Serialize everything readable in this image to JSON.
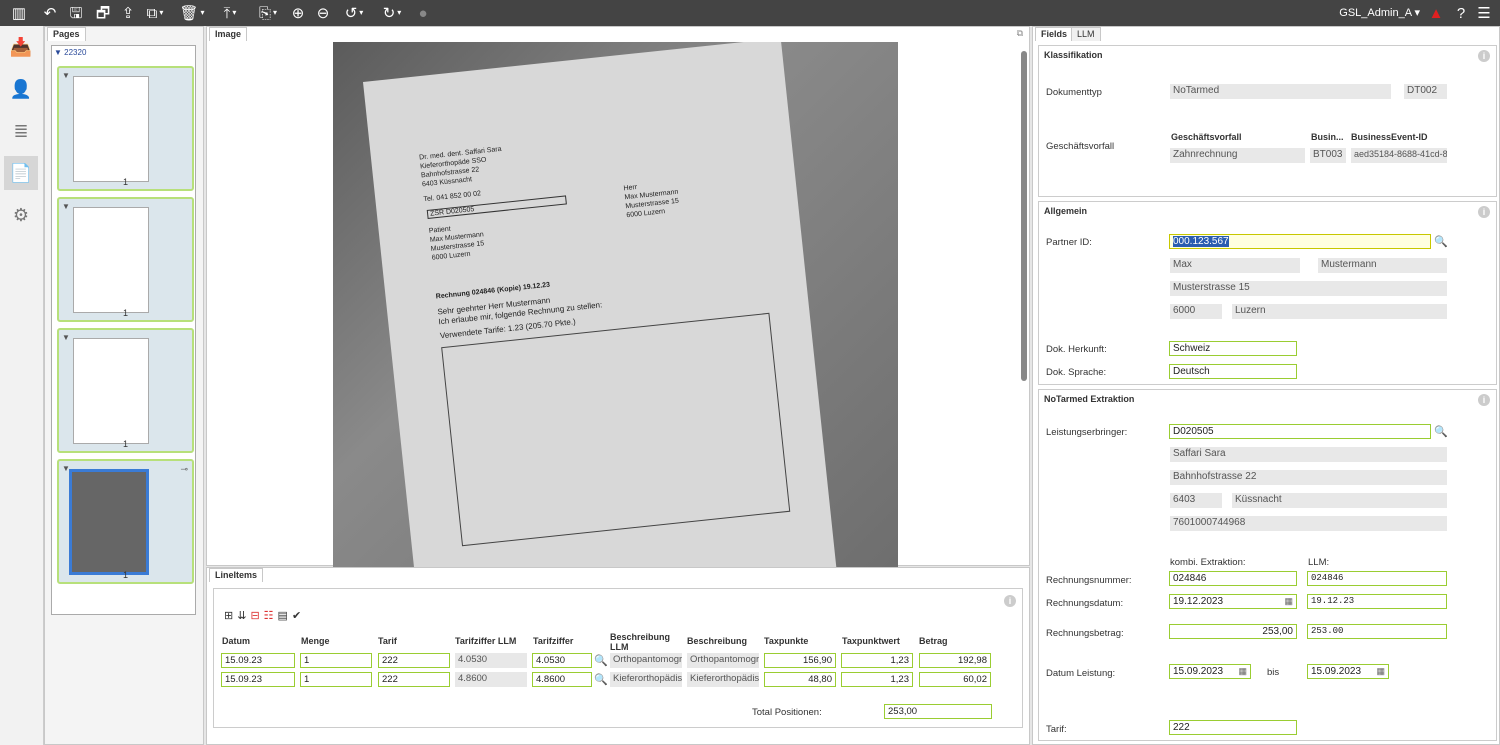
{
  "topbar": {
    "user": "GSL_Admin_A"
  },
  "pages": {
    "tab": "Pages",
    "group": "22320",
    "thumbs": [
      "1",
      "1",
      "1",
      "1"
    ]
  },
  "image": {
    "tab": "Image",
    "doc_lines": [
      "Dr. med. dent. Saffari Sara",
      "Kieferorthopäde SSO",
      "Bahnhofstrasse 22",
      "6403 Küssnacht",
      "Tel. 041 852 00 02",
      "ZSR D020505",
      "Patient",
      "Max Mustermann",
      "Musterstrasse 15",
      "6000 Luzern",
      "Herr",
      "Max Mustermann",
      "Musterstrasse 15",
      "6000 Luzern",
      "Rechnung 024846 (Kopie)    19.12.23",
      "Sehr geehrter Herr Mustermann",
      "Ich erlaube mir, folgende Rechnung zu stellen:",
      "Verwendete Tarife: 1.23 (205.70 Pkte.)"
    ]
  },
  "lineitems": {
    "tab": "LineItems",
    "headers": [
      "Datum",
      "Menge",
      "Tarif",
      "Tarifziffer LLM",
      "Tarifziffer",
      "Beschreibung LLM",
      "Beschreibung",
      "Taxpunkte",
      "Taxpunktwert",
      "Betrag"
    ],
    "rows": [
      [
        "15.09.23",
        "1",
        "222",
        "4.0530",
        "4.0530",
        "Orthopantomogra",
        "Orthopantomogra",
        "156,90",
        "1,23",
        "192,98"
      ],
      [
        "15.09.23",
        "1",
        "222",
        "4.8600",
        "4.8600",
        "Kieferorthopädisc",
        "Kieferorthopädisc",
        "48,80",
        "1,23",
        "60,02"
      ]
    ],
    "total_label": "Total Positionen:",
    "total_value": "253,00"
  },
  "fields": {
    "tabs": [
      "Fields",
      "LLM"
    ],
    "klass": {
      "title": "Klassifikation",
      "doctype_label": "Dokumenttyp",
      "doctype": "NoTarmed",
      "doctype_code": "DT002",
      "gv_label": "Geschäftsvorfall",
      "col1": "Geschäftsvorfall",
      "col2": "Busin...",
      "col3": "BusinessEvent-ID",
      "gv": "Zahnrechnung",
      "bt": "BT003",
      "beid": "aed35184-8688-41cd-8"
    },
    "allg": {
      "title": "Allgemein",
      "partner_label": "Partner ID:",
      "partner": "000.123.567",
      "first": "Max",
      "last": "Mustermann",
      "street": "Musterstrasse 15",
      "zip": "6000",
      "city": "Luzern",
      "herkunft_label": "Dok. Herkunft:",
      "herkunft": "Schweiz",
      "sprache_label": "Dok. Sprache:",
      "sprache": "Deutsch"
    },
    "extr": {
      "title": "NoTarmed Extraktion",
      "lb_label": "Leistungserbringer:",
      "lb": "D020505",
      "name": "Saffari Sara",
      "street": "Bahnhofstrasse 22",
      "zip": "6403",
      "city": "Küssnacht",
      "gln": "7601000744968",
      "kombi": "kombi. Extraktion:",
      "llm": "LLM:",
      "rn_label": "Rechnungsnummer:",
      "rn": "024846",
      "rn_llm": "024846",
      "rd_label": "Rechnungsdatum:",
      "rd": "19.12.2023",
      "rd_llm": "19.12.23",
      "rb_label": "Rechnungsbetrag:",
      "rb": "253,00",
      "rb_llm": "253.00",
      "dl_label": "Datum Leistung:",
      "dl_from": "15.09.2023",
      "bis": "bis",
      "dl_to": "15.09.2023",
      "tarif_label": "Tarif:",
      "tarif": "222"
    }
  }
}
